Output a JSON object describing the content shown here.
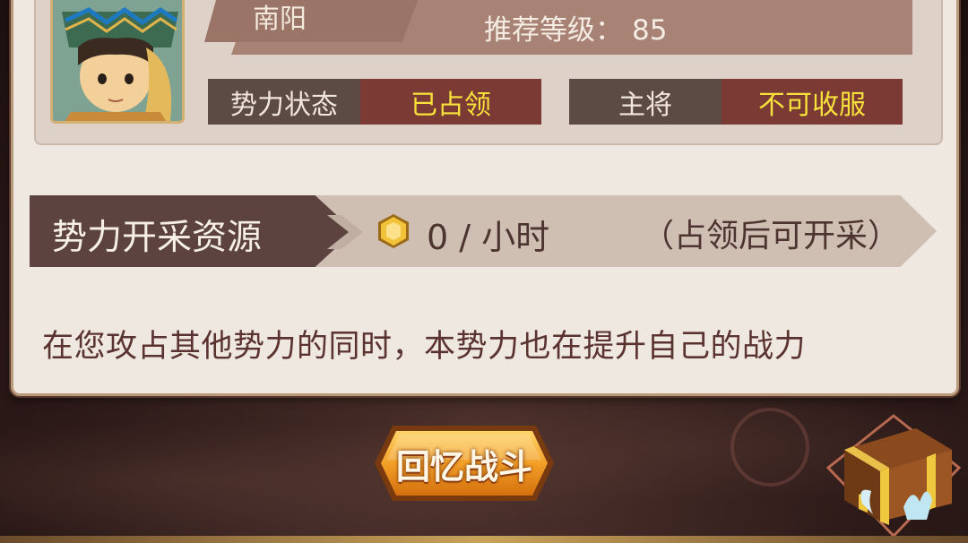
{
  "city": {
    "name": "南阳",
    "level_label": "推荐等级：",
    "level_value": "85"
  },
  "stats": [
    {
      "key": "势力状态",
      "value": "已占领"
    },
    {
      "key": "主将",
      "value": "不可收服"
    }
  ],
  "resource": {
    "title": "势力开采资源",
    "amount": "0 / 小时",
    "note": "（占领后可开采）",
    "icon": "gold-coin-icon"
  },
  "description": "在您攻占其他势力的同时，本势力也在提升自己的战力",
  "buttons": {
    "recall": "回忆战斗"
  },
  "colors": {
    "accent_yellow": "#f6e23a",
    "occupied_bg": "#7c3a34",
    "button_orange": "#f09a1e"
  }
}
